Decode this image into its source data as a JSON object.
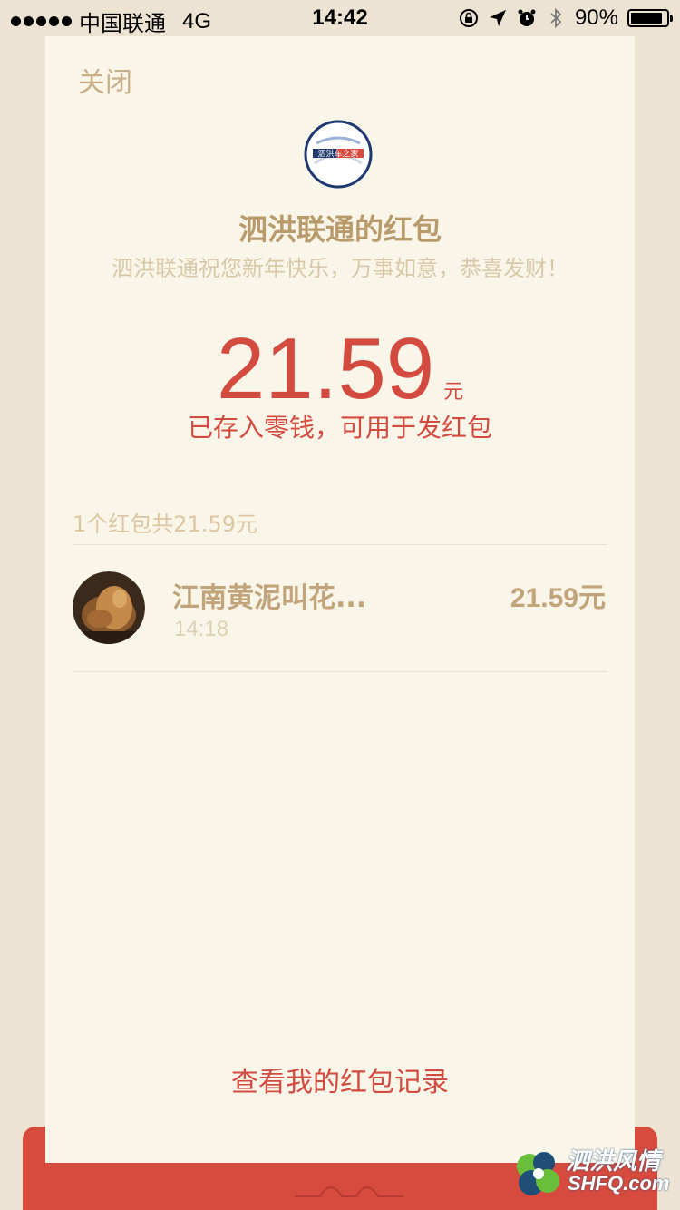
{
  "status_bar": {
    "carrier": "中国联通",
    "network": "4G",
    "time": "14:42",
    "battery": "90%",
    "battery_level": 0.9
  },
  "card": {
    "close_label": "关闭",
    "sender": "泗洪联通的红包",
    "wish": "泗洪联通祝您新年快乐，万事如意，恭喜发财！",
    "amount": "21.59",
    "unit": "元",
    "saved_note": "已存入零钱，可用于发红包",
    "summary": "1个红包共21.59元",
    "history_link": "查看我的红包记录"
  },
  "records": [
    {
      "name": "江南黄泥叫花...",
      "time": "14:18",
      "amount": "21.59元"
    }
  ],
  "watermark": {
    "title": "泗洪风情",
    "site": "SHFQ.com"
  },
  "colors": {
    "background": "#ece3d2",
    "card": "#faf5e9",
    "red": "#d34a3f",
    "gold": "#c2a47a"
  }
}
